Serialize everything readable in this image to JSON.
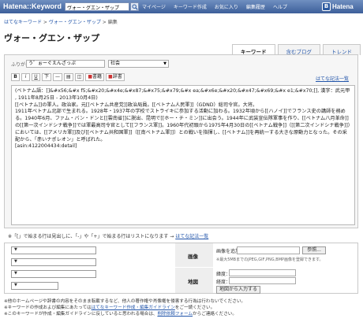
{
  "topbar": {
    "brand": "Hatena::Keyword",
    "search_value": "ヴォー・グエン・ザップ",
    "nav": [
      "マイページ",
      "キーワード作成",
      "お気に入り",
      "編集履歴",
      "ヘルプ"
    ],
    "logo_text": "Hatena"
  },
  "breadcrumb": {
    "root": "はてなキーワード",
    "sep1": " > ",
    "page": "ヴォー・グエン・ザップ",
    "sep2": " > ",
    "current": "編集"
  },
  "page_title": "ヴォー・グエン・ザップ",
  "tabs": [
    "キーワード",
    "含むブログ",
    "トレンド"
  ],
  "form": {
    "furigana_label": "ふりがな",
    "furigana_value": "う゛ぉーぐえんざっぷ",
    "category_value": "社会",
    "help_link": "はてな記法一覧",
    "toolbar": [
      "B",
      "i",
      "U",
      "下",
      "—",
      "▤",
      "◫",
      "書籍",
      "辞書"
    ],
    "body": "(ベトナム語：[]&#x56;&#x f5;&#x20;&#x4e;&#x87;&#x75;&#x79;&#x ea;&#x6e;&#x20;&#x47;&#x69;&#x e1;&#x70;[], 漢字：武元甲 , 1911年8月25日 - 2013年10月4日)\n[[ベトナム]]の軍人。政治家。元[[ベトナム共産党]]政治局員。[[ベトナム人民軍]]（GDND）総司令官。大将。\n1911年ベトナム北部で生まれる。1928年・1937年の学校でストライキに参加する活動に加わる。1932年頃から[[ハノイ]]でフランス史の講師を務める。1940年6月、ファム・バン・ドンと[[雲南省]]に脱出、昆明で[[ホー・チ・ミン]]に出会う。1944年に武装宣伝隊軍事を作り、[[ベトナム八月革命]]の[[第一次インドシナ戦争]]では軍最高司令官として[[フランス軍]]。1960年代初頭から1975年4月30日の[[ベトナム戦争]]（[[第二次インドシナ戦争]]）においては、[[アメリカ軍]]及び[[ベトナム共和国軍]]（[[南ベトナム軍]]）との戦いを指揮し、[[ベトナム]]を再統一する大きな原動力となった。その采配から、「赤いナポレオン」と呼ばれた。\n[asin:4122004434:detail]"
  },
  "note_line": {
    "text": "※「[」で始まる行は見出しに、「-」や「+」で始まる行はリストになります → ",
    "link": "はてな記法一覧"
  },
  "lower": {
    "image_label": "画像",
    "image_add_label": "画像を追加：",
    "browse_button": "参照...",
    "image_note": "※最大5MBまでのJPEG,GIF,PNG,BMP画像を登録できます。",
    "map_label": "地図",
    "lat_label": "緯度：",
    "lng_label": "経度：",
    "map_button": "地図から入力する",
    "select_arrow": "▼"
  },
  "footer": {
    "line1": "※他のホームページや辞書の内容をそのまま転載するなど、他人の著作権や肖像権を侵害する行為は行わないでください。",
    "line2_pre": "※キーワードの作成および編集にあたっては",
    "line2_link": "はてなキーワード作成・編集ガイドライン",
    "line2_post": "をご一読ください。",
    "line3_pre": "※このキーワードが作成・編集ガイドラインに反していると思われる場合は、",
    "line3_link": "削除依頼フォーム",
    "line3_post": "からご連絡ください。"
  }
}
